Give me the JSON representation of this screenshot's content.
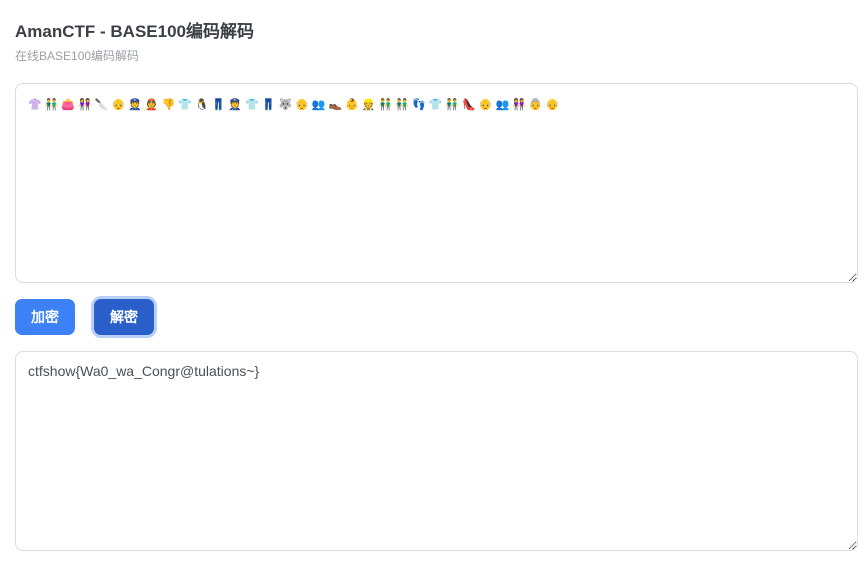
{
  "header": {
    "title": "AmanCTF - BASE100编码解码",
    "subtitle": "在线BASE100编码解码"
  },
  "input": {
    "value": "👚👬👛👭🔪👴👮👲👎👕🐧👖👮👕👖🐺👴👥👞👶👷👬👬👣👕👬👠👴👥👭👵👴"
  },
  "buttons": {
    "encrypt_label": "加密",
    "decrypt_label": "解密"
  },
  "output": {
    "value": "ctfshow{Wa0_wa_Congr@tulations~}"
  }
}
